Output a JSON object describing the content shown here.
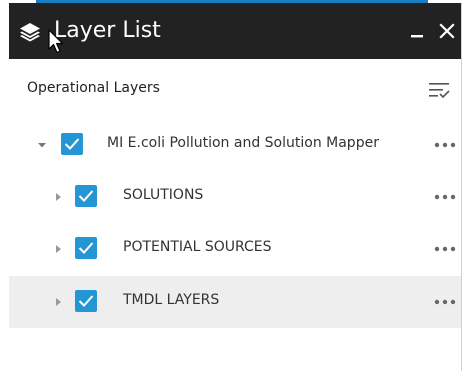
{
  "window": {
    "title": "Layer List",
    "minimize_glyph": "–",
    "close_glyph": "✕",
    "icon": "layers-icon"
  },
  "section": {
    "title": "Operational Layers",
    "filter_icon": "filter-icon"
  },
  "layers": [
    {
      "label": "MI E.coli Pollution and Solution Mapper",
      "checked": true,
      "expanded": true,
      "level": 0
    },
    {
      "label": "SOLUTIONS",
      "checked": true,
      "expanded": false,
      "level": 1
    },
    {
      "label": "POTENTIAL SOURCES",
      "checked": true,
      "expanded": false,
      "level": 1
    },
    {
      "label": "TMDL LAYERS",
      "checked": true,
      "expanded": false,
      "level": 1,
      "hovered": true
    }
  ],
  "colors": {
    "titlebar": "#222222",
    "checkbox": "#2496d3",
    "accent": "#1a7fbf",
    "row_hover": "#eeeeee"
  }
}
